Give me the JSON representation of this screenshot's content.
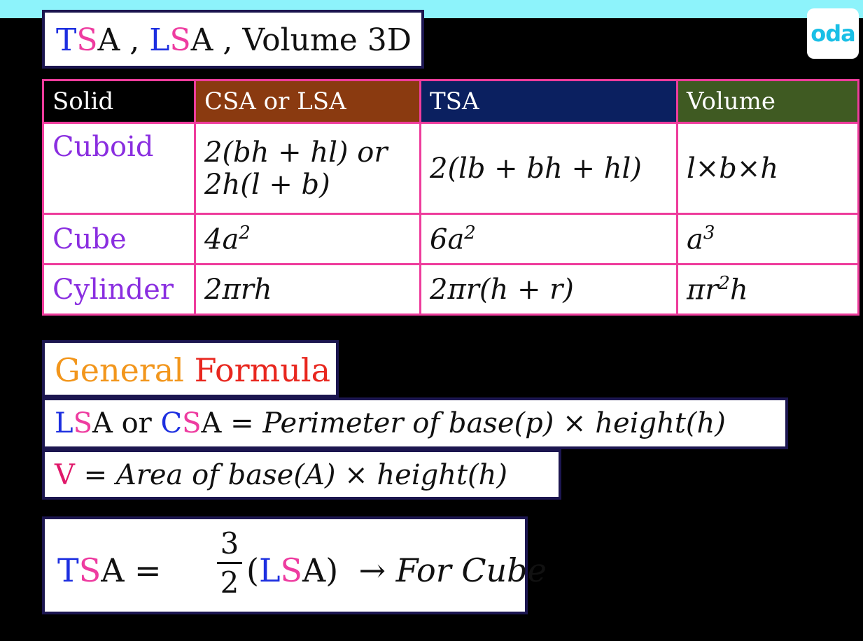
{
  "title": {
    "t": "T",
    "s": "S",
    "a": "A ,",
    "l": "L",
    "s2": "S",
    "rest": "A , Volume 3D"
  },
  "logo": "oda",
  "table": {
    "headers": [
      "Solid",
      "CSA or LSA",
      "TSA",
      "Volume"
    ],
    "rows": [
      {
        "solid": "Cuboid",
        "csa_line1": "2(bh + hl) or",
        "csa_line2": "2h(l + b)",
        "tsa": "2(lb + bh + hl)",
        "vol": "l×b×h"
      },
      {
        "solid": "Cube",
        "csa": "4a",
        "csa_sup": "2",
        "tsa": "6a",
        "tsa_sup": "2",
        "vol": "a",
        "vol_sup": "3"
      },
      {
        "solid": "Cylinder",
        "csa": "2πrh",
        "tsa": "2πr(h + r)",
        "vol_pre": "πr",
        "vol_sup": "2",
        "vol_post": "h"
      }
    ]
  },
  "general": {
    "word1": "General",
    "word2": "Formula"
  },
  "lsa_formula": {
    "l": "L",
    "s": "S",
    "a_or": "A or",
    "c": "C",
    "s2": "S",
    "a": "A",
    "rhs": "= Perimeter of base(p) × height(h)"
  },
  "volume_formula": {
    "v": "V",
    "rhs": "= Area of base(A) × height(h)"
  },
  "cube_formula": {
    "t": "T",
    "s": "S",
    "a_eq": "A =",
    "num": "3",
    "den": "2",
    "open": "(",
    "l": "L",
    "s2": "S",
    "a_close": "A)",
    "arrow": "→",
    "for_cube": "For Cube"
  }
}
